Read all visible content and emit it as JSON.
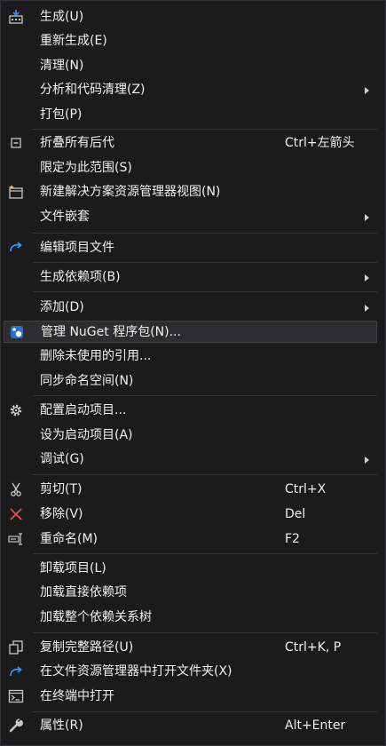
{
  "menu": {
    "items": [
      {
        "label": "生成(U)",
        "shortcut": "",
        "icon": "build-icon"
      },
      {
        "label": "重新生成(E)",
        "shortcut": ""
      },
      {
        "label": "清理(N)",
        "shortcut": ""
      },
      {
        "label": "分析和代码清理(Z)",
        "shortcut": "",
        "submenu": true
      },
      {
        "label": "打包(P)",
        "shortcut": ""
      },
      {
        "label": "折叠所有后代",
        "shortcut": "Ctrl+左箭头",
        "icon": "collapse-icon"
      },
      {
        "label": "限定为此范围(S)",
        "shortcut": ""
      },
      {
        "label": "新建解决方案资源管理器视图(N)",
        "shortcut": "",
        "icon": "new-view-icon"
      },
      {
        "label": "文件嵌套",
        "shortcut": "",
        "submenu": true
      },
      {
        "label": "编辑项目文件",
        "shortcut": "",
        "icon": "edit-project-icon"
      },
      {
        "label": "生成依赖项(B)",
        "shortcut": "",
        "submenu": true
      },
      {
        "label": "添加(D)",
        "shortcut": "",
        "submenu": true
      },
      {
        "label": "管理 NuGet 程序包(N)...",
        "shortcut": "",
        "icon": "nuget-icon",
        "highlighted": true
      },
      {
        "label": "删除未使用的引用...",
        "shortcut": ""
      },
      {
        "label": "同步命名空间(N)",
        "shortcut": ""
      },
      {
        "label": "配置启动项目...",
        "shortcut": "",
        "icon": "gear-icon"
      },
      {
        "label": "设为启动项目(A)",
        "shortcut": ""
      },
      {
        "label": "调试(G)",
        "shortcut": "",
        "submenu": true
      },
      {
        "label": "剪切(T)",
        "shortcut": "Ctrl+X",
        "icon": "scissors-icon"
      },
      {
        "label": "移除(V)",
        "shortcut": "Del",
        "icon": "remove-x-icon"
      },
      {
        "label": "重命名(M)",
        "shortcut": "F2",
        "icon": "rename-icon"
      },
      {
        "label": "卸载项目(L)",
        "shortcut": ""
      },
      {
        "label": "加载直接依赖项",
        "shortcut": ""
      },
      {
        "label": "加载整个依赖关系树",
        "shortcut": ""
      },
      {
        "label": "复制完整路径(U)",
        "shortcut": "Ctrl+K, P",
        "icon": "copy-icon"
      },
      {
        "label": "在文件资源管理器中打开文件夹(X)",
        "shortcut": "",
        "icon": "open-folder-arrow-icon"
      },
      {
        "label": "在终端中打开",
        "shortcut": "",
        "icon": "terminal-icon"
      },
      {
        "label": "属性(R)",
        "shortcut": "Alt+Enter",
        "icon": "wrench-icon"
      }
    ]
  },
  "colors": {
    "background": "#1b1b1c",
    "text": "#f1f1f1",
    "separator": "#333337",
    "highlight": "#2d2d30",
    "icon_blue": "#3794ff",
    "icon_red": "#e05252"
  }
}
